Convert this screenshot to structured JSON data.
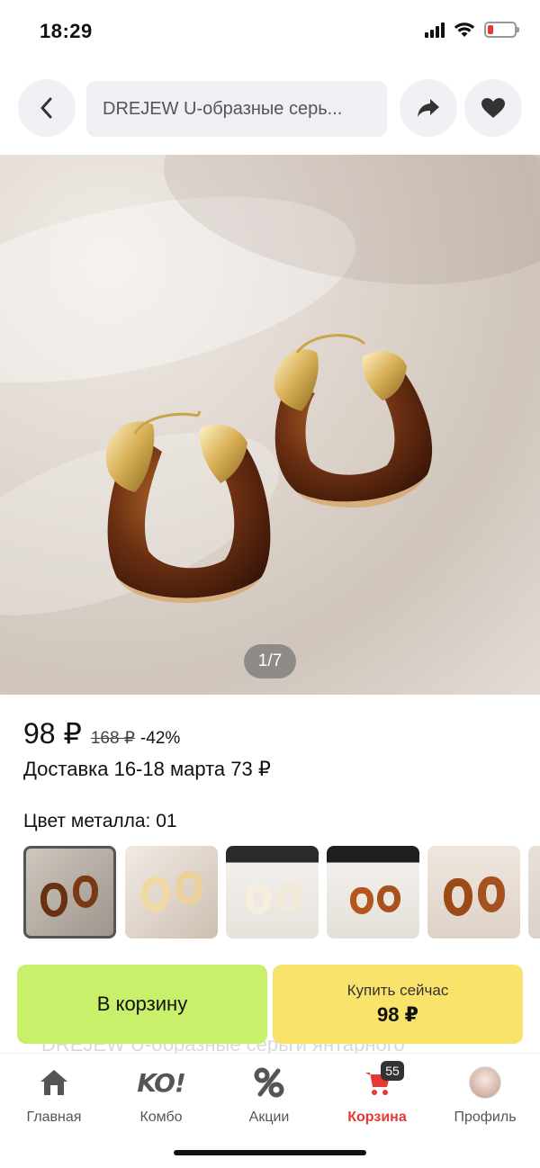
{
  "status_bar": {
    "time": "18:29"
  },
  "header": {
    "title": "DREJEW U-образные серь..."
  },
  "gallery": {
    "counter": "1/7"
  },
  "price": {
    "current": "98 ₽",
    "old": "168 ₽",
    "discount": "-42%"
  },
  "delivery": "Доставка 16-18 марта 73 ₽",
  "variant": {
    "label": "Цвет металла: 01",
    "thumbnails": [
      {
        "name": "amber-gold",
        "selected": true
      },
      {
        "name": "cream-gold",
        "selected": false
      },
      {
        "name": "white-gold",
        "selected": false
      },
      {
        "name": "amber-small",
        "selected": false
      },
      {
        "name": "amber-large",
        "selected": false
      }
    ]
  },
  "actions": {
    "cart_label": "В корзину",
    "buy_label": "Купить сейчас",
    "buy_price": "98 ₽"
  },
  "background_text": "DREJEW U-образные серьги янтарного",
  "tabbar": {
    "home": "Главная",
    "combo": "Комбо",
    "combo_logo": "KO!",
    "promo": "Акции",
    "cart": "Корзина",
    "cart_badge": "55",
    "profile": "Профиль"
  },
  "colors": {
    "cart_button": "#c9f06b",
    "buy_button": "#fae36b",
    "active_tab": "#e53935"
  }
}
